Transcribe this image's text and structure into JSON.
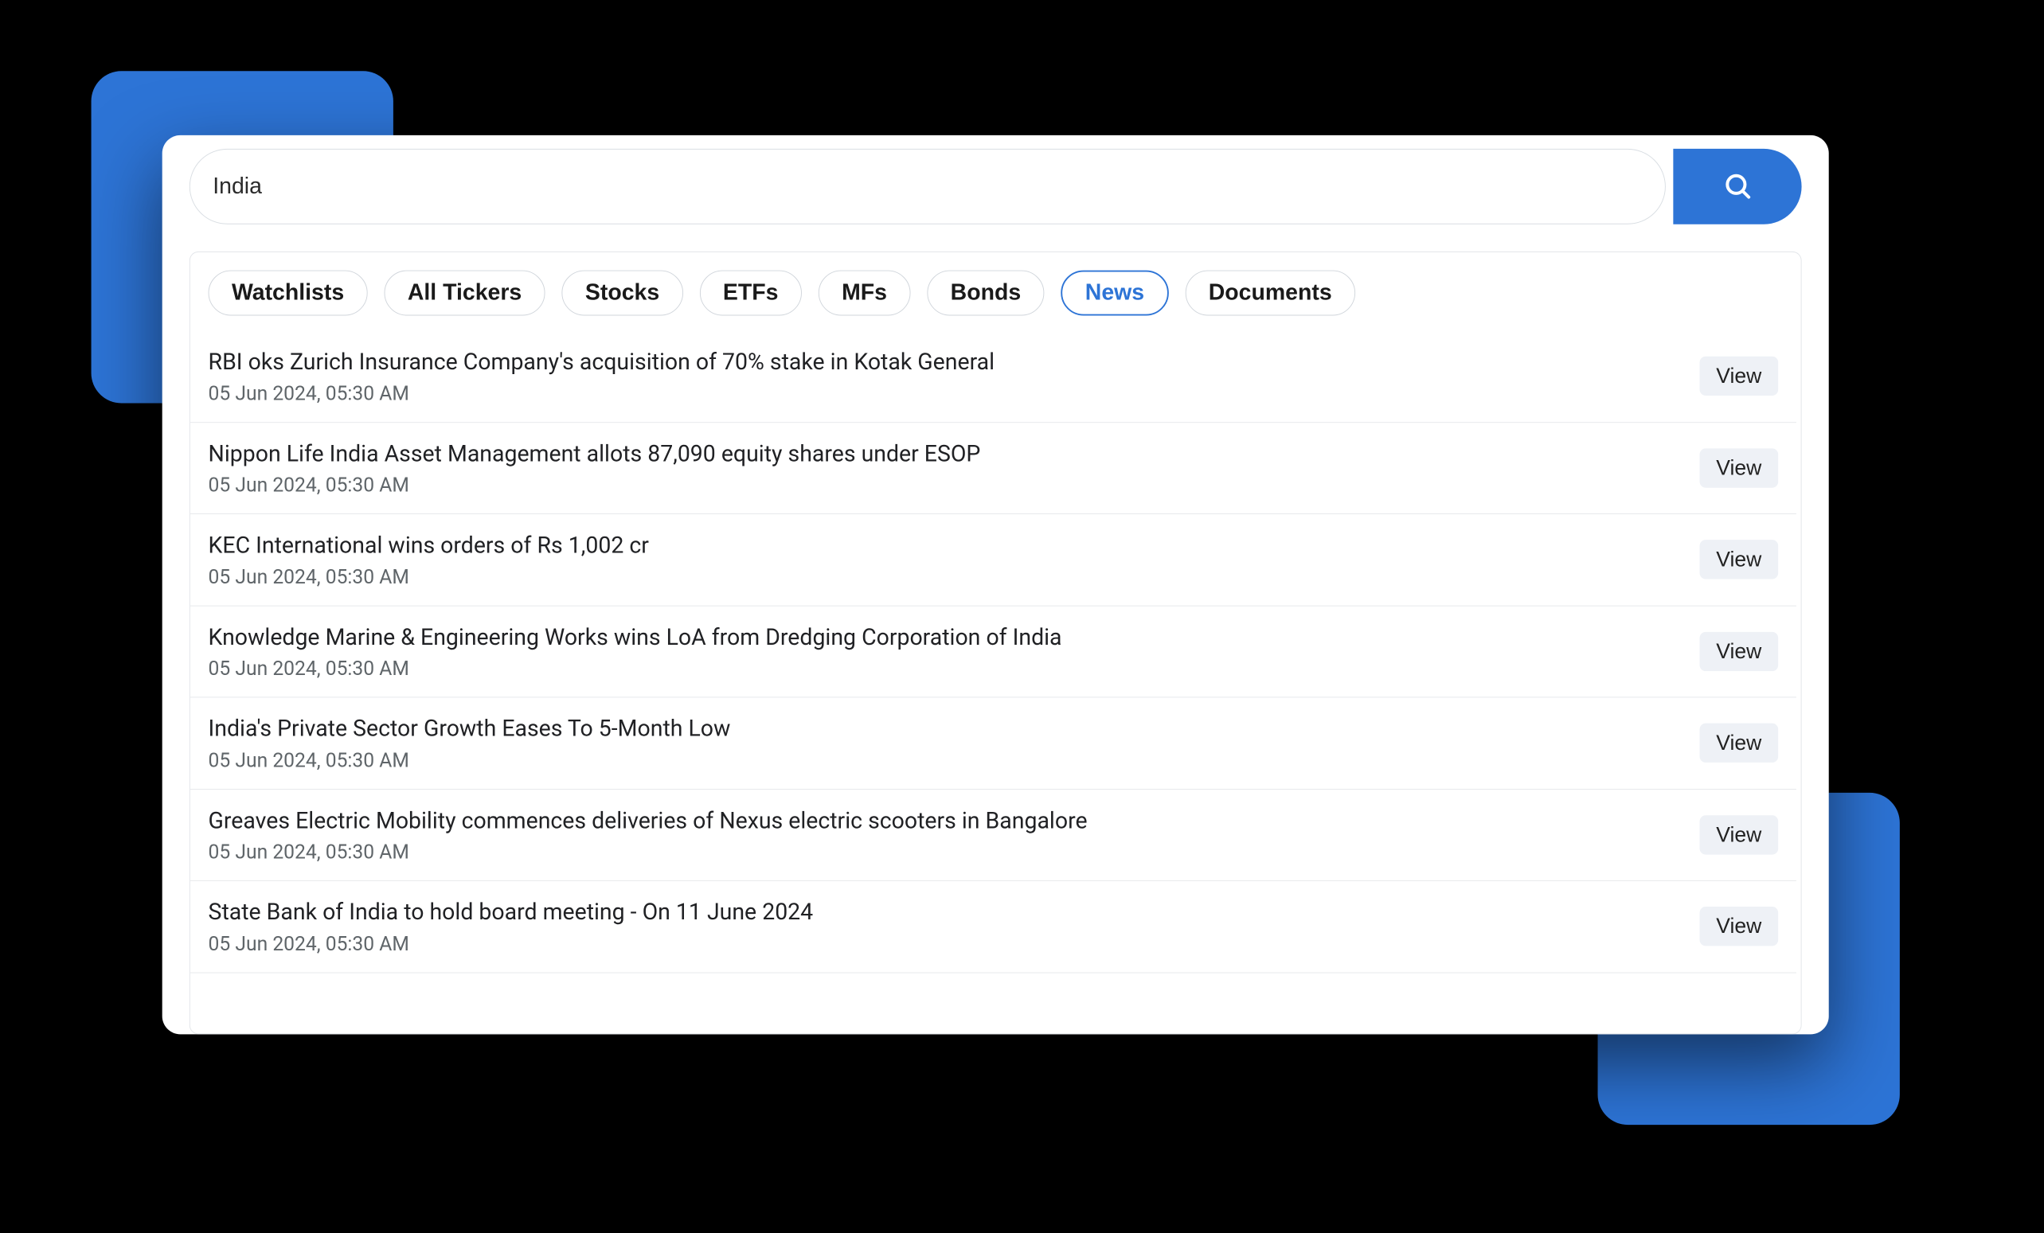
{
  "search": {
    "value": "India"
  },
  "tabs": [
    {
      "label": "Watchlists",
      "active": false
    },
    {
      "label": "All Tickers",
      "active": false
    },
    {
      "label": "Stocks",
      "active": false
    },
    {
      "label": "ETFs",
      "active": false
    },
    {
      "label": "MFs",
      "active": false
    },
    {
      "label": "Bonds",
      "active": false
    },
    {
      "label": "News",
      "active": true
    },
    {
      "label": "Documents",
      "active": false
    }
  ],
  "view_label": "View",
  "news": [
    {
      "headline": "RBI oks Zurich Insurance Company's acquisition of 70% stake in Kotak General",
      "timestamp": "05 Jun 2024, 05:30 AM"
    },
    {
      "headline": "Nippon Life India Asset Management allots 87,090 equity shares under ESOP",
      "timestamp": "05 Jun 2024, 05:30 AM"
    },
    {
      "headline": "KEC International wins orders of Rs 1,002 cr",
      "timestamp": "05 Jun 2024, 05:30 AM"
    },
    {
      "headline": "Knowledge Marine & Engineering Works wins LoA from Dredging Corporation of India",
      "timestamp": "05 Jun 2024, 05:30 AM"
    },
    {
      "headline": "India's Private Sector Growth Eases To 5-Month Low",
      "timestamp": "05 Jun 2024, 05:30 AM"
    },
    {
      "headline": "Greaves Electric Mobility commences deliveries of Nexus electric scooters in Bangalore",
      "timestamp": "05 Jun 2024, 05:30 AM"
    },
    {
      "headline": "State Bank of India to hold board meeting - On 11 June 2024",
      "timestamp": "05 Jun 2024, 05:30 AM"
    }
  ]
}
